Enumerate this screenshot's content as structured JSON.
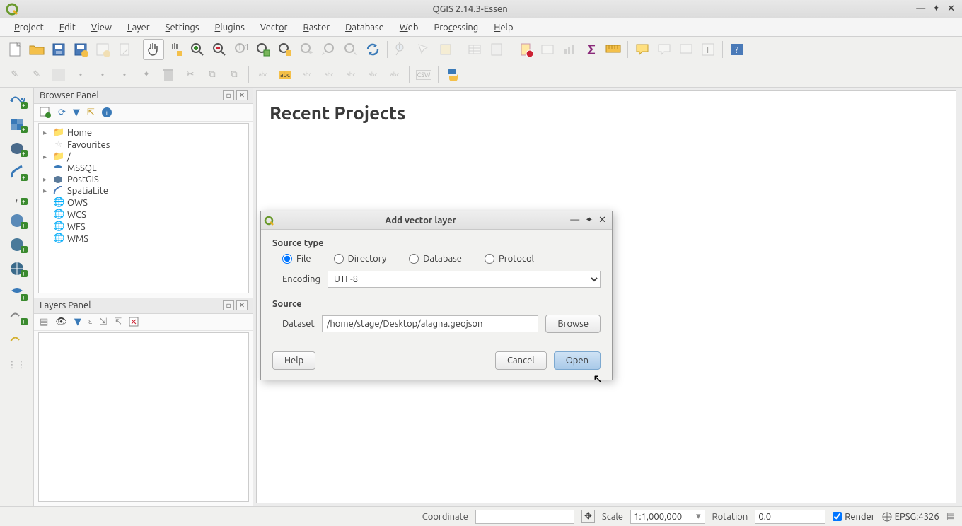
{
  "window": {
    "title": "QGIS 2.14.3-Essen"
  },
  "menu": {
    "items": [
      "Project",
      "Edit",
      "View",
      "Layer",
      "Settings",
      "Plugins",
      "Vector",
      "Raster",
      "Database",
      "Web",
      "Processing",
      "Help"
    ]
  },
  "browser_panel": {
    "title": "Browser Panel",
    "items": [
      {
        "label": "Home",
        "icon": "folder",
        "expand": true
      },
      {
        "label": "Favourites",
        "icon": "star",
        "expand": false
      },
      {
        "label": "/",
        "icon": "folder",
        "expand": true
      },
      {
        "label": "MSSQL",
        "icon": "db",
        "expand": false
      },
      {
        "label": "PostGIS",
        "icon": "elephant",
        "expand": true
      },
      {
        "label": "SpatiaLite",
        "icon": "feather",
        "expand": true
      },
      {
        "label": "OWS",
        "icon": "globe",
        "expand": false
      },
      {
        "label": "WCS",
        "icon": "globe",
        "expand": false
      },
      {
        "label": "WFS",
        "icon": "globe",
        "expand": false
      },
      {
        "label": "WMS",
        "icon": "globe",
        "expand": false
      }
    ]
  },
  "layers_panel": {
    "title": "Layers Panel"
  },
  "content": {
    "heading": "Recent Projects"
  },
  "dialog": {
    "title": "Add vector layer",
    "source_type_label": "Source type",
    "radios": {
      "file": "File",
      "directory": "Directory",
      "database": "Database",
      "protocol": "Protocol"
    },
    "encoding_label": "Encoding",
    "encoding_value": "UTF-8",
    "source_label": "Source",
    "dataset_label": "Dataset",
    "dataset_value": "/home/stage/Desktop/alagna.geojson",
    "browse": "Browse",
    "help": "Help",
    "cancel": "Cancel",
    "open": "Open"
  },
  "status": {
    "coordinate_label": "Coordinate",
    "scale_label": "Scale",
    "scale_value": "1:1,000,000",
    "rotation_label": "Rotation",
    "rotation_value": "0.0",
    "render_label": "Render",
    "crs": "EPSG:4326"
  }
}
